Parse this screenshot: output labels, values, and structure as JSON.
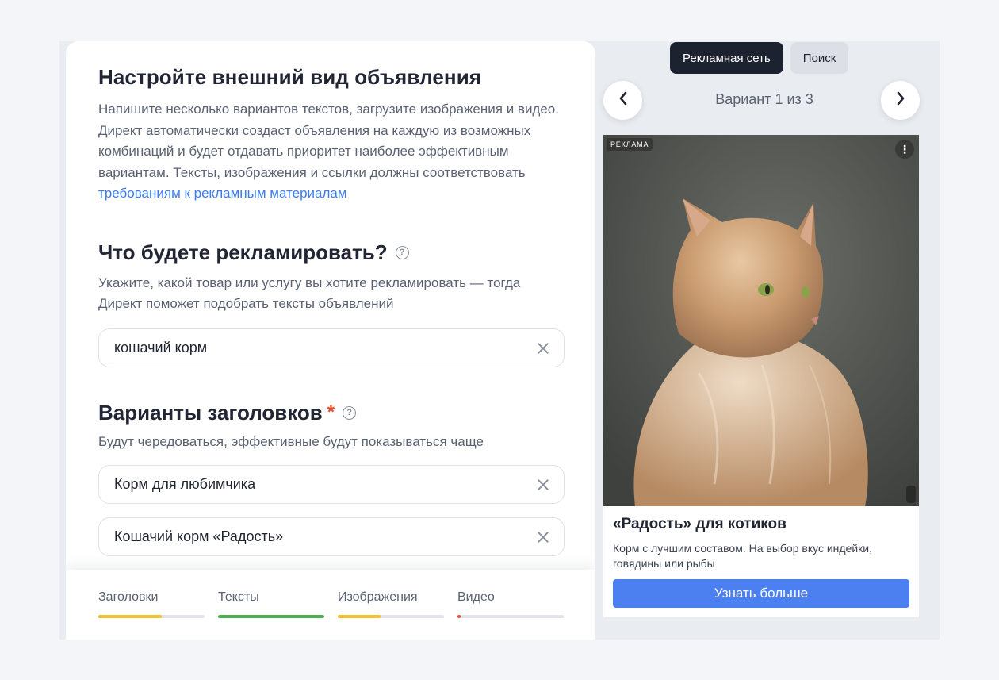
{
  "form": {
    "title": "Настройте внешний вид объявления",
    "lead_text": "Напишите несколько вариантов текстов, загрузите изображения и видео. Директ автоматически создаст объявления на каждую из возможных комбинаций и будет отдавать приоритет наиболее эффективным вариантам. Тексты, изображения и ссылки должны соответствовать",
    "lead_link": "требованиям к рекламным материалам",
    "advertise": {
      "title": "Что будете рекламировать?",
      "hint": "Укажите, какой товар или услугу вы хотите рекламировать — тогда Директ поможет подобрать тексты объявлений",
      "value": "кошачий корм"
    },
    "headlines": {
      "title": "Варианты заголовков",
      "required_mark": "*",
      "hint": "Будут чередоваться, эффективные будут показываться чаще",
      "values": [
        "Корм для любимчика",
        "Кошачий корм «Радость»"
      ]
    }
  },
  "progress": {
    "items": [
      {
        "label": "Заголовки",
        "fill": 0.6,
        "color": "#f2c230"
      },
      {
        "label": "Тексты",
        "fill": 1.0,
        "color": "#4cae4f"
      },
      {
        "label": "Изображения",
        "fill": 0.4,
        "color": "#f2c230"
      },
      {
        "label": "Видео",
        "fill": 0.03,
        "color": "#f24a2b"
      }
    ]
  },
  "preview": {
    "tabs": [
      "Рекламная сеть",
      "Поиск"
    ],
    "active_tab": "Рекламная сеть",
    "variant_text": "Вариант 1 из 3",
    "ad": {
      "badge": "РЕКЛАМА",
      "menu_icon": "⋮",
      "title": "«Радость» для котиков",
      "text": "Корм с лучшим составом. На выбор вкус индейки, говядины или рыбы",
      "button": "Узнать больше"
    }
  },
  "icons": {
    "help": "?",
    "prev": "‹",
    "next": "›"
  }
}
